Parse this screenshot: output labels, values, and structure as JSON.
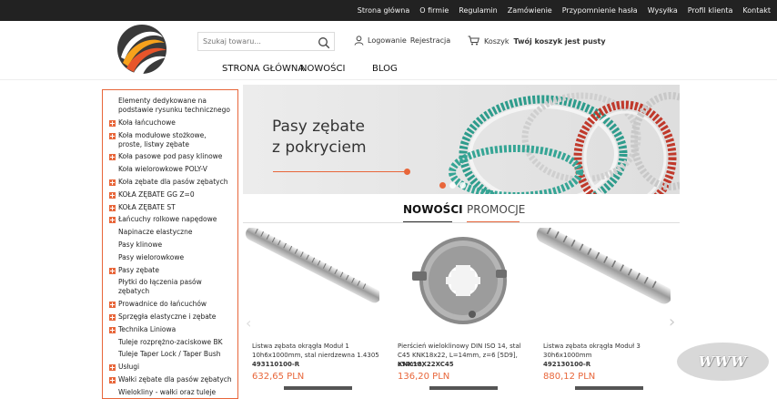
{
  "topnav": {
    "items": [
      "Strona główna",
      "O firmie",
      "Regulamin",
      "Zamówienie",
      "Przypomnienie hasła",
      "Wysyłka",
      "Profil klienta",
      "Kontakt"
    ]
  },
  "search": {
    "placeholder": "Szukaj towaru..."
  },
  "account": {
    "login": "Logowanie",
    "register": "Rejestracja"
  },
  "cart": {
    "label": "Koszyk",
    "status": "Twój koszyk jest pusty"
  },
  "mainnav": {
    "items": [
      "STRONA GŁÓWNA",
      "NOWOŚCI",
      "BLOG"
    ]
  },
  "sidebar": {
    "items": [
      {
        "label": "Elementy dedykowane na podstawie rysunku technicznego",
        "expandable": false
      },
      {
        "label": "Koła łańcuchowe",
        "expandable": true
      },
      {
        "label": "Koła modułowe stożkowe, proste, listwy zębate",
        "expandable": true
      },
      {
        "label": "Koła pasowe pod pasy klinowe",
        "expandable": true
      },
      {
        "label": "Koła wielorowkowe POLY-V",
        "expandable": false
      },
      {
        "label": "Koła zębate dla pasów zębatych",
        "expandable": true
      },
      {
        "label": "KOŁA ZĘBATE GG Z=0",
        "expandable": true
      },
      {
        "label": "KOŁA ZĘBATE ST",
        "expandable": true
      },
      {
        "label": "Łańcuchy rolkowe napędowe",
        "expandable": true
      },
      {
        "label": "Napinacze elastyczne",
        "expandable": false
      },
      {
        "label": "Pasy klinowe",
        "expandable": false
      },
      {
        "label": "Pasy wielorowkowe",
        "expandable": false
      },
      {
        "label": "Pasy zębate",
        "expandable": true
      },
      {
        "label": "Płytki do łączenia pasów zębatych",
        "expandable": false
      },
      {
        "label": "Prowadnice do łańcuchów",
        "expandable": true
      },
      {
        "label": "Sprzęgła elastyczne i zębate",
        "expandable": true
      },
      {
        "label": "Technika Liniowa",
        "expandable": true
      },
      {
        "label": "Tuleje rozprężno-zaciskowe BK",
        "expandable": false
      },
      {
        "label": "Tuleje Taper Lock / Taper Bush",
        "expandable": false
      },
      {
        "label": "Usługi",
        "expandable": true
      },
      {
        "label": "Wałki zębate dla pasów zębatych",
        "expandable": true
      },
      {
        "label": "Wielokliny - wałki oraz tuleje",
        "expandable": false
      }
    ]
  },
  "banner": {
    "line1": "Pasy zębate",
    "line2": "z pokryciem",
    "slide_count": 3,
    "active_slide": 0
  },
  "tabs": {
    "active": "NOWOŚCI",
    "inactive": "PROMOCJE"
  },
  "products": [
    {
      "name": "Listwa zębata okrągła Moduł 1 10h6x1000mm, stal nierdzewna 1.4305",
      "code": "493110100-R",
      "price": "632,65 PLN"
    },
    {
      "name": "Pierścień wieloklinowy DIN ISO 14, stal C45 KNK18x22, L=14mm, z=6 [5D9], ø54mm,",
      "code": "KNK18X22XC45",
      "price": "136,20 PLN"
    },
    {
      "name": "Listwa zębata okrągła Moduł 3 30h6x1000mm",
      "code": "492130100-R",
      "price": "880,12 PLN"
    }
  ],
  "badge": {
    "text": "WWW"
  },
  "colors": {
    "accent": "#e8663a",
    "topbar": "#222222",
    "dark": "#333333"
  }
}
